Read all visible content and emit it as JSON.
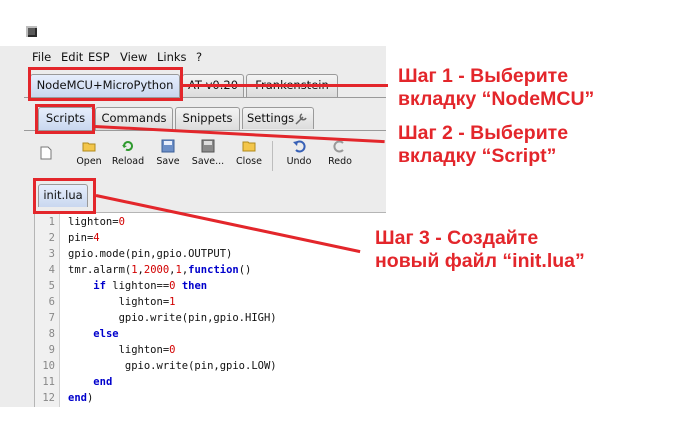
{
  "menu": [
    "File",
    "Edit",
    "ESP",
    "View",
    "Links",
    "?"
  ],
  "board_tabs": [
    "NodeMCU+MicroPython",
    "AT v0.20",
    "Frankenstein"
  ],
  "sub_tabs": [
    "Scripts",
    "Commands",
    "Snippets",
    "Settings"
  ],
  "toolbar": {
    "new_label": "",
    "open_label": "Open",
    "reload_label": "Reload",
    "save_label": "Save",
    "saveas_label": "Save...",
    "close_label": "Close",
    "undo_label": "Undo",
    "redo_label": "Redo"
  },
  "file_tab": "init.lua",
  "code_lines": [
    [
      "1",
      "lighton=0"
    ],
    [
      "2",
      "pin=4"
    ],
    [
      "3",
      "gpio.mode(pin,gpio.OUTPUT)"
    ],
    [
      "4",
      "tmr.alarm(1,2000,1,function()"
    ],
    [
      "5",
      "    if lighton==0 then"
    ],
    [
      "6",
      "        lighton=1"
    ],
    [
      "7",
      "        gpio.write(pin,gpio.HIGH)"
    ],
    [
      "8",
      "    else"
    ],
    [
      "9",
      "        lighton=0"
    ],
    [
      "10",
      "         gpio.write(pin,gpio.LOW)"
    ],
    [
      "11",
      "    end"
    ],
    [
      "12",
      "end)"
    ]
  ],
  "annotations": {
    "step1_line1": "Шаг 1 - Выберите",
    "step1_line2": "вкладку “NodeMCU”",
    "step2_line1": "Шаг 2 - Выберите",
    "step2_line2": "вкладку “Script”",
    "step3_line1": "Шаг 3 - Создайте",
    "step3_line2": "новый файл “init.lua”"
  },
  "colors": {
    "annotation_red": "#e3262b",
    "keyword_blue": "#0000cc",
    "number_red": "#d20000"
  }
}
